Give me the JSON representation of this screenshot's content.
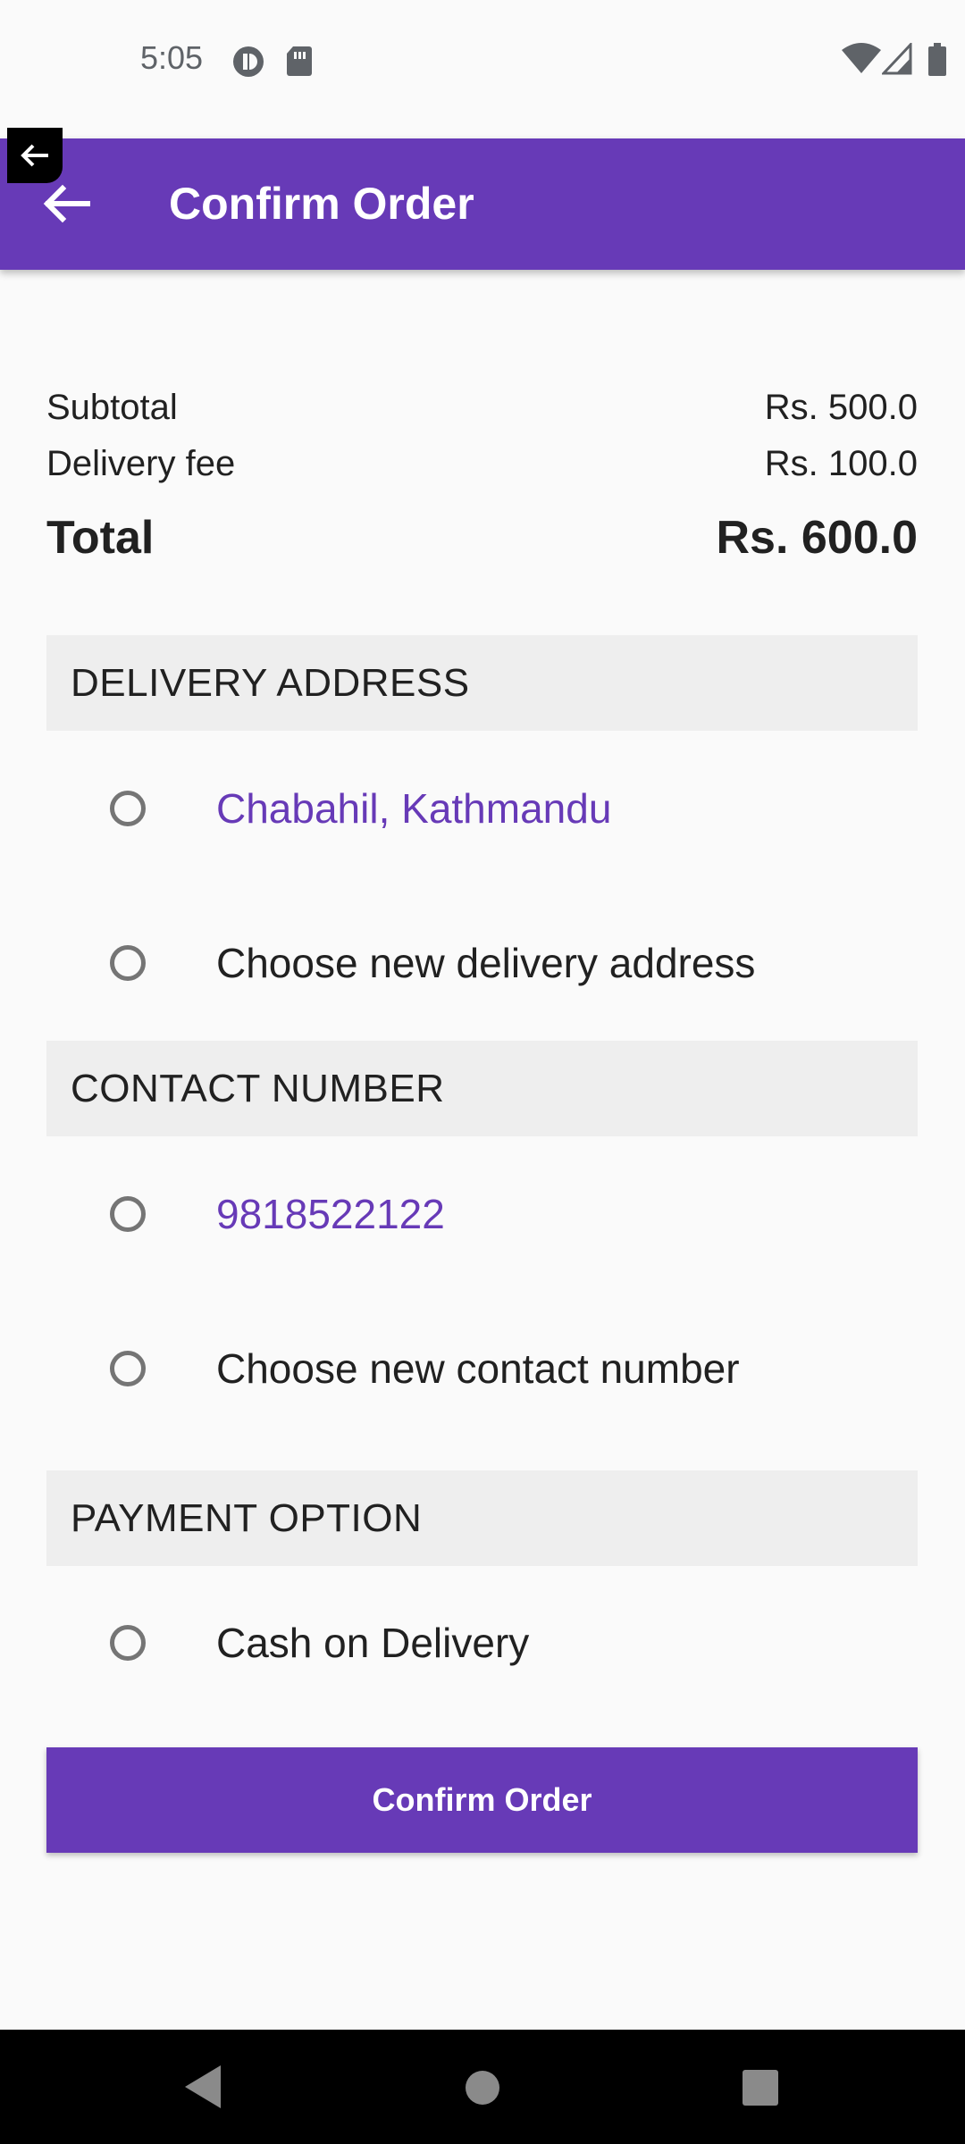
{
  "status_bar": {
    "time": "5:05",
    "icons": [
      "circle-status-icon",
      "sim-card-icon",
      "wifi-icon",
      "signal-icon",
      "battery-icon"
    ]
  },
  "app_bar": {
    "title": "Confirm Order",
    "back_icon": "arrow-left-icon",
    "background": "#673ab7"
  },
  "summary": {
    "subtotal_label": "Subtotal",
    "subtotal_value": "Rs. 500.0",
    "delivery_label": "Delivery fee",
    "delivery_value": "Rs. 100.0",
    "total_label": "Total",
    "total_value": "Rs. 600.0"
  },
  "delivery_address": {
    "header": "DELIVERY ADDRESS",
    "saved_option": "Chabahil, Kathmandu",
    "new_option": "Choose new delivery address"
  },
  "contact_number": {
    "header": "CONTACT NUMBER",
    "saved_option": "9818522122",
    "new_option": "Choose new contact number"
  },
  "payment_option": {
    "header": "PAYMENT OPTION",
    "option": "Cash on Delivery"
  },
  "confirm_button_label": "Confirm Order",
  "colors": {
    "primary": "#673ab7",
    "section_bg": "#eeeeee",
    "background": "#fafafa"
  }
}
